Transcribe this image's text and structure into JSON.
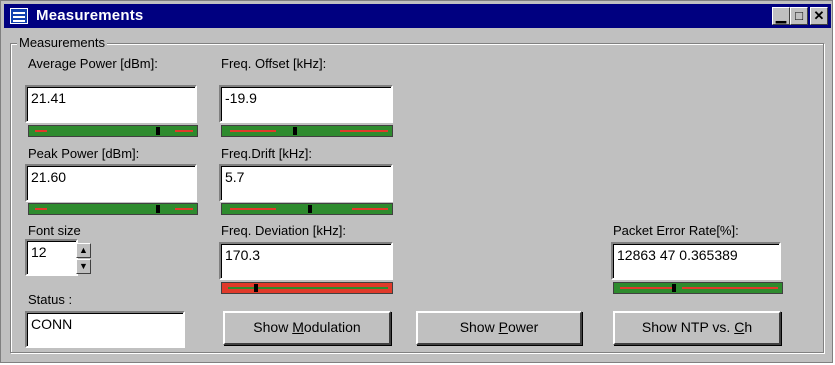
{
  "window": {
    "title": "Measurements"
  },
  "group": {
    "label": "Measurements"
  },
  "average_power": {
    "label": "Average Power [dBm]:",
    "value": "21.41"
  },
  "peak_power": {
    "label": "Peak Power [dBm]:",
    "value": "21.60"
  },
  "freq_offset": {
    "label": "Freq. Offset [kHz]:",
    "value": "-19.9"
  },
  "freq_drift": {
    "label": "Freq.Drift [kHz]:",
    "value": "5.7"
  },
  "freq_deviation": {
    "label": "Freq. Deviation [kHz]:",
    "value": "170.3"
  },
  "font_size": {
    "label": "Font size",
    "value": "12"
  },
  "status": {
    "label": "Status :",
    "value": "CONN"
  },
  "per": {
    "label": "Packet Error Rate[%]:",
    "value": "12863 47 0.365389"
  },
  "buttons": {
    "show_modulation": {
      "pre": "Show ",
      "mnemonic": "M",
      "post": "odulation"
    },
    "show_power": {
      "pre": "Show ",
      "mnemonic": "P",
      "post": "ower"
    },
    "show_ntp": {
      "pre": "Show NTP vs. ",
      "mnemonic": "C",
      "post": "h"
    }
  },
  "gauges": {
    "average_power": {
      "bg": "#2e8b2e",
      "bar": "#e03a2a",
      "marker_fraction": 0.77
    },
    "peak_power": {
      "bg": "#2e8b2e",
      "bar": "#e03a2a",
      "marker_fraction": 0.77
    },
    "freq_offset": {
      "bg": "#2e8b2e",
      "bar": "#e03a2a",
      "marker_fraction": 0.43
    },
    "freq_drift": {
      "bg": "#2e8b2e",
      "bar": "#e03a2a",
      "marker_fraction": 0.52
    },
    "freq_deviation": {
      "bg": "#e03a2a",
      "bar": "#2e8b2e",
      "marker_fraction": 0.2
    },
    "per": {
      "bg": "#2e8b2e",
      "bar": "#e03a2a",
      "marker_fraction": 0.36
    }
  },
  "colors": {
    "titlebar": "#000080",
    "face": "#c0c0c0",
    "green": "#2e8b2e",
    "red": "#e03a2a"
  }
}
